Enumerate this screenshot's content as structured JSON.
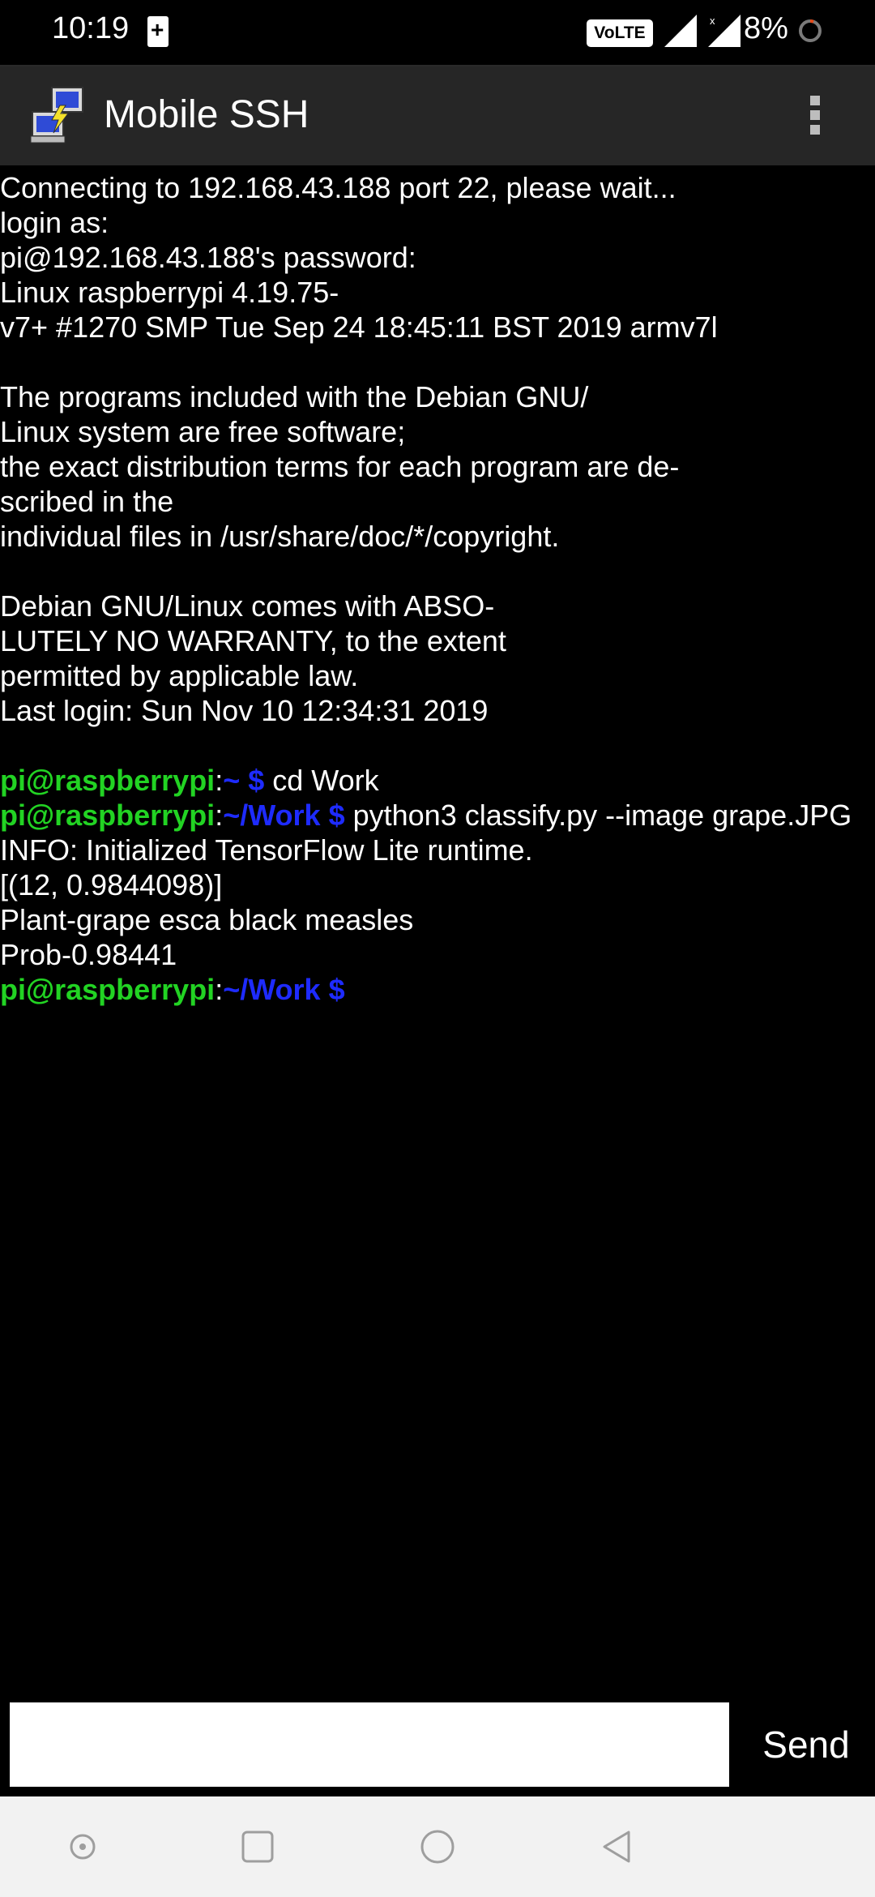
{
  "status_bar": {
    "time": "10:19",
    "network_badge": "VoLTE",
    "battery_percent": "8%",
    "icons": [
      "battery-charging-icon",
      "signal-icon",
      "signal-no-data-icon",
      "battery-ring-icon"
    ]
  },
  "app_bar": {
    "title": "Mobile SSH",
    "logo_icon": "putty-computers-icon",
    "menu_icon": "overflow-menu-icon"
  },
  "terminal": {
    "lines": [
      "Connecting to 192.168.43.188 port 22, please wait...",
      "login as:",
      "pi@192.168.43.188's password:",
      "Linux raspberrypi 4.19.75-",
      "v7+ #1270 SMP Tue Sep 24 18:45:11 BST 2019 armv7l",
      "",
      "The programs included with the Debian GNU/",
      "Linux system are free software;",
      "the exact distribution terms for each program are de-",
      "scribed in the",
      "individual files in /usr/share/doc/*/copyright.",
      "",
      "Debian GNU/Linux comes with ABSO-",
      "LUTELY NO WARRANTY, to the extent",
      "permitted by applicable law.",
      "Last login: Sun Nov 10 12:34:31 2019",
      ""
    ],
    "prompt_user": "pi@raspberrypi",
    "prompt_colon": ":",
    "commands": [
      {
        "path": "~ $",
        "cmd": " cd Work"
      },
      {
        "path": "~/Work $",
        "cmd": " python3 classify.py --image grape.JPG"
      }
    ],
    "output_lines": [
      "INFO: Initialized TensorFlow Lite runtime.",
      "[(12, 0.9844098)]",
      "Plant-grape esca black measles",
      "Prob-0.98441"
    ],
    "final_prompt_path": "~/Work $"
  },
  "input": {
    "value": "",
    "placeholder": "",
    "send_label": "Send"
  },
  "nav_bar": {
    "buttons": [
      "assistant-dot-icon",
      "recents-square-icon",
      "home-circle-icon",
      "back-triangle-icon"
    ]
  },
  "colors": {
    "prompt_user": "#22d323",
    "prompt_path": "#1e2bff",
    "terminal_bg": "#000000",
    "app_bar_bg": "#262626",
    "nav_bar_bg": "#f2f2f2"
  }
}
